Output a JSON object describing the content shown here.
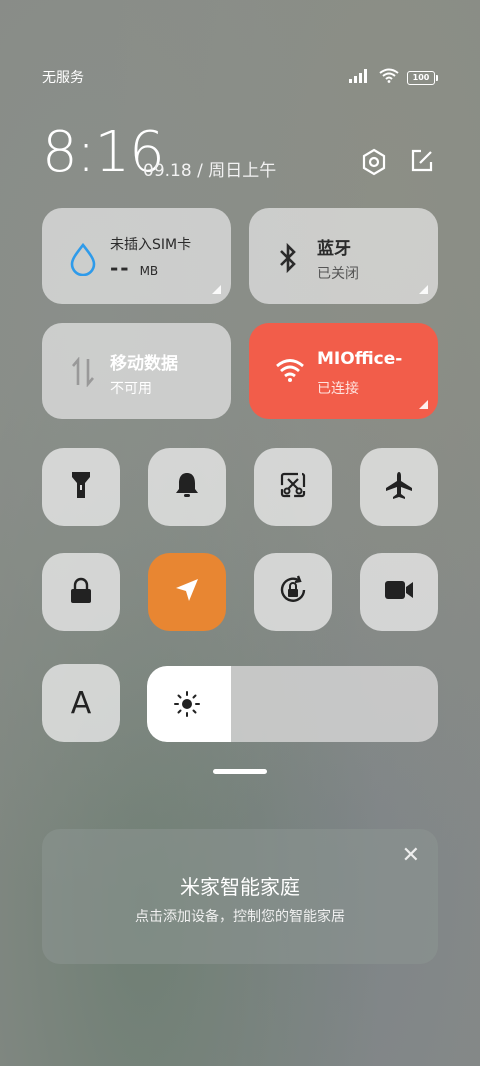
{
  "status": {
    "carrier": "无服务",
    "battery": "100"
  },
  "clock": {
    "time": "8:16",
    "date": "09.18 / 周日上午"
  },
  "tiles": {
    "sim": {
      "title": "未插入SIM卡",
      "value": "-- ",
      "unit": "MB"
    },
    "bluetooth": {
      "title": "蓝牙",
      "state": "已关闭"
    },
    "mobile_data": {
      "title": "移动数据",
      "state": "不可用"
    },
    "wifi": {
      "title": "MIOffice-",
      "state": "已连接"
    }
  },
  "buttons": {
    "auto_brightness_label": "A"
  },
  "brightness": {
    "level": 0.29
  },
  "card": {
    "title": "米家智能家庭",
    "subtitle": "点击添加设备，控制您的智能家居",
    "close": "✕"
  },
  "colors": {
    "wifi_active": "#f25d4a",
    "location_active": "#e88632"
  }
}
